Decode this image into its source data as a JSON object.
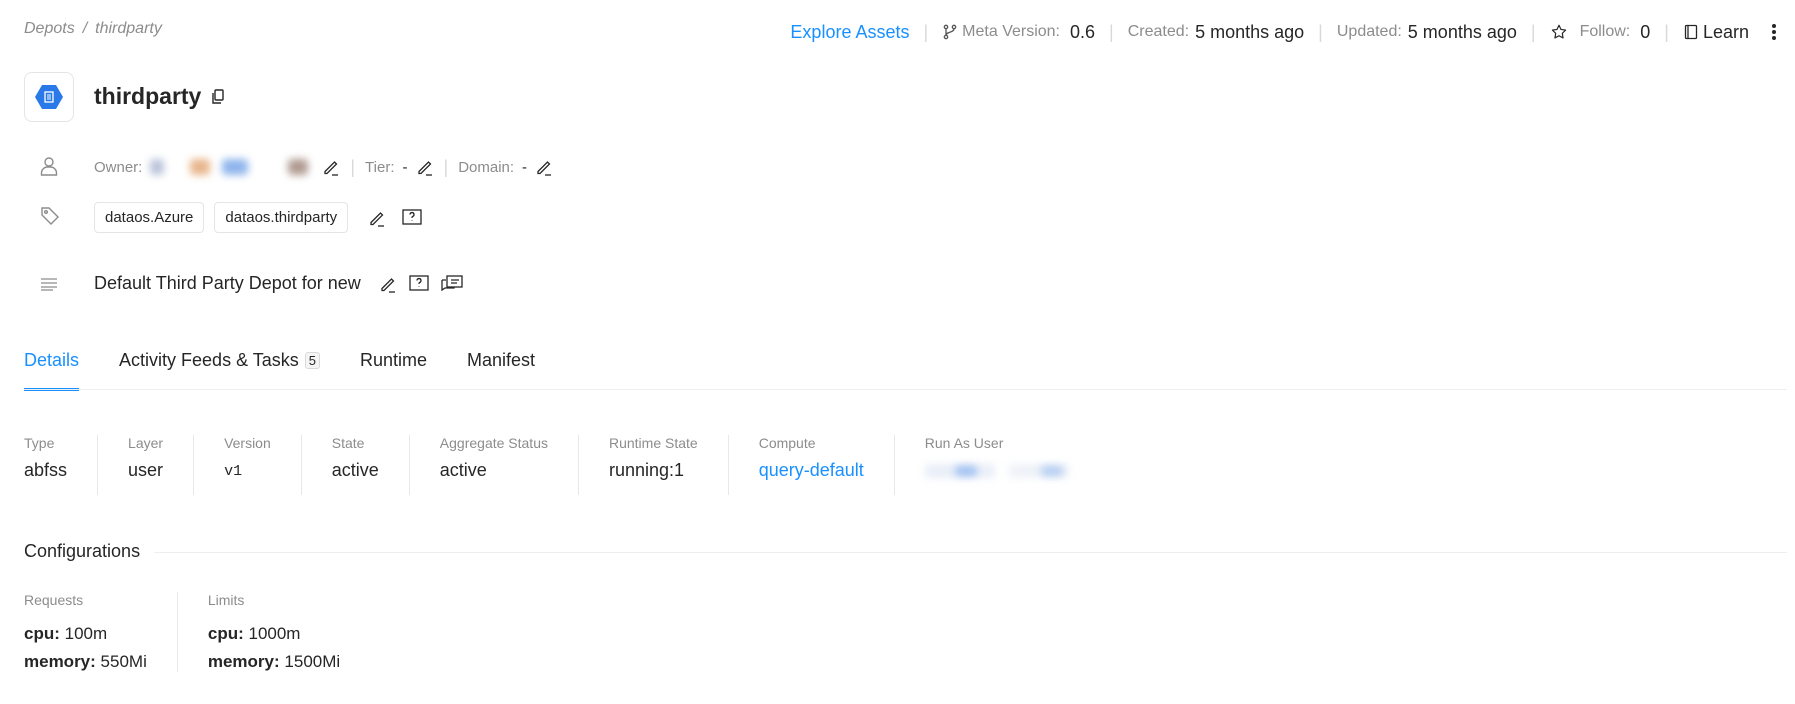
{
  "breadcrumb": {
    "root": "Depots",
    "separator": "/",
    "current": "thirdparty"
  },
  "topbar": {
    "explore_label": "Explore Assets",
    "meta_version_label": "Meta Version:",
    "meta_version_value": "0.6",
    "created_label": "Created:",
    "created_value": "5 months ago",
    "updated_label": "Updated:",
    "updated_value": "5 months ago",
    "follow_label": "Follow:",
    "follow_value": "0",
    "learn_label": "Learn"
  },
  "entity": {
    "title": "thirdparty"
  },
  "owner": {
    "label": "Owner:",
    "tier_label": "Tier:",
    "tier_value": "-",
    "domain_label": "Domain:",
    "domain_value": "-"
  },
  "tags": [
    "dataos.Azure",
    "dataos.thirdparty"
  ],
  "description": "Default Third Party Depot for new",
  "tabs": {
    "details": "Details",
    "activity": "Activity Feeds & Tasks",
    "activity_count": "5",
    "runtime": "Runtime",
    "manifest": "Manifest"
  },
  "details": {
    "type_label": "Type",
    "type_value": "abfss",
    "layer_label": "Layer",
    "layer_value": "user",
    "version_label": "Version",
    "version_value": "v1",
    "state_label": "State",
    "state_value": "active",
    "aggregate_label": "Aggregate Status",
    "aggregate_value": "active",
    "runtime_label": "Runtime State",
    "runtime_value": "running:1",
    "compute_label": "Compute",
    "compute_value": "query-default",
    "runas_label": "Run As User"
  },
  "configurations": {
    "title": "Configurations",
    "requests_label": "Requests",
    "limits_label": "Limits",
    "cpu_key": "cpu:",
    "memory_key": "memory:",
    "requests_cpu": "100m",
    "requests_memory": "550Mi",
    "limits_cpu": "1000m",
    "limits_memory": "1500Mi"
  },
  "colors": {
    "accent": "#1890ff",
    "text": "#262626",
    "muted": "#8c8c8c",
    "border": "#e5e5e5"
  }
}
